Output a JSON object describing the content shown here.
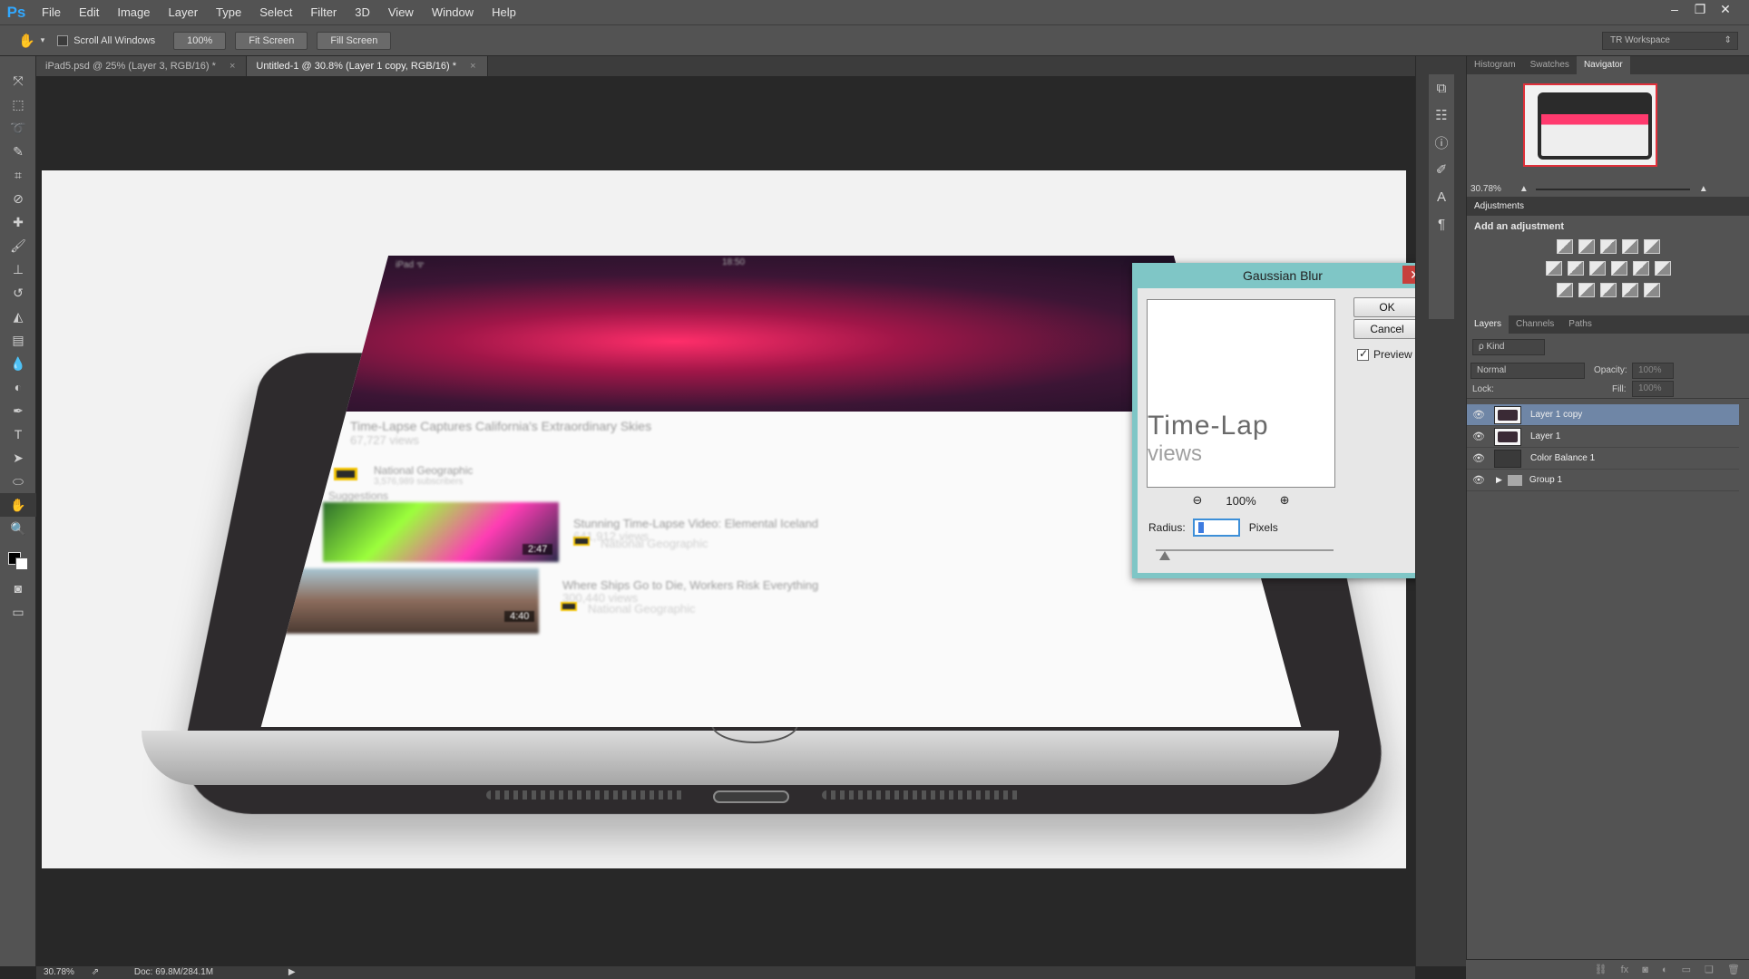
{
  "app": {
    "logo": "Ps"
  },
  "menu": [
    "File",
    "Edit",
    "Image",
    "Layer",
    "Type",
    "Select",
    "Filter",
    "3D",
    "View",
    "Window",
    "Help"
  ],
  "window_controls": {
    "minimize": "–",
    "restore": "❐",
    "close": "✕"
  },
  "options": {
    "tool_icon": "hand-icon",
    "scroll_all_label": "Scroll All Windows",
    "zoom_100_label": "100%",
    "fit_screen_label": "Fit Screen",
    "fill_screen_label": "Fill Screen",
    "workspace": "TR Workspace"
  },
  "tabs": [
    {
      "label": "iPad5.psd @ 25% (Layer 3, RGB/16) *",
      "close": "×"
    },
    {
      "label": "Untitled-1 @ 30.8% (Layer 1 copy, RGB/16) *",
      "close": "×"
    }
  ],
  "tools": [
    "move-icon",
    "marquee-icon",
    "lasso-icon",
    "quick-select-icon",
    "crop-icon",
    "eyedropper-icon",
    "healing-icon",
    "brush-icon",
    "stamp-icon",
    "history-brush-icon",
    "eraser-icon",
    "gradient-icon",
    "blur-icon",
    "dodge-icon",
    "pen-icon",
    "type-icon",
    "path-select-icon",
    "ellipse-icon",
    "hand-icon",
    "zoom-icon"
  ],
  "ipad_screen": {
    "status_left": "iPad ᯤ",
    "status_center": "18:50",
    "video_title": "Time-Lapse Captures California's Extraordinary Skies",
    "video_views": "67,727 views",
    "channel": "National Geographic",
    "subscribers": "3,576,989 subscribers",
    "suggestions_heading": "Suggestions",
    "s1_title": "Stunning Time-Lapse Video: Elemental Iceland",
    "s1_views": "641,912 views",
    "s1_channel": "National Geographic",
    "s1_duration": "2:47",
    "s2_title": "Where Ships Go to Die, Workers Risk Everything",
    "s2_views": "300,440 views",
    "s2_channel": "National Geographic",
    "s2_duration": "4:40"
  },
  "dialog": {
    "title": "Gaussian Blur",
    "close": "✕",
    "ok_label": "OK",
    "cancel_label": "Cancel",
    "preview_label": "Preview",
    "preview_checked": true,
    "preview_text_big": "Time-Lap",
    "preview_text_small": "views",
    "zoom_value": "100%",
    "radius_label": "Radius:",
    "radius_unit": "Pixels"
  },
  "panels": {
    "top_tabs": [
      "Histogram",
      "Swatches",
      "Navigator"
    ],
    "navigator_zoom": "30.78%",
    "adjustments_title": "Adjustments",
    "adjustments_label": "Add an adjustment",
    "layer_tabs": [
      "Layers",
      "Channels",
      "Paths"
    ],
    "kind_label": "ρ Kind",
    "blend_mode": "Normal",
    "opacity_label": "Opacity:",
    "opacity_value": "100%",
    "lock_label": "Lock:",
    "fill_label": "Fill:",
    "fill_value": "100%",
    "layers": [
      {
        "name": "Layer 1 copy",
        "selected": true
      },
      {
        "name": "Layer 1",
        "selected": false
      },
      {
        "name": "Color Balance 1",
        "selected": false
      },
      {
        "name": "Group 1",
        "selected": false
      }
    ]
  },
  "status": {
    "zoom": "30.78%",
    "doc": "Doc: 69.8M/284.1M"
  }
}
